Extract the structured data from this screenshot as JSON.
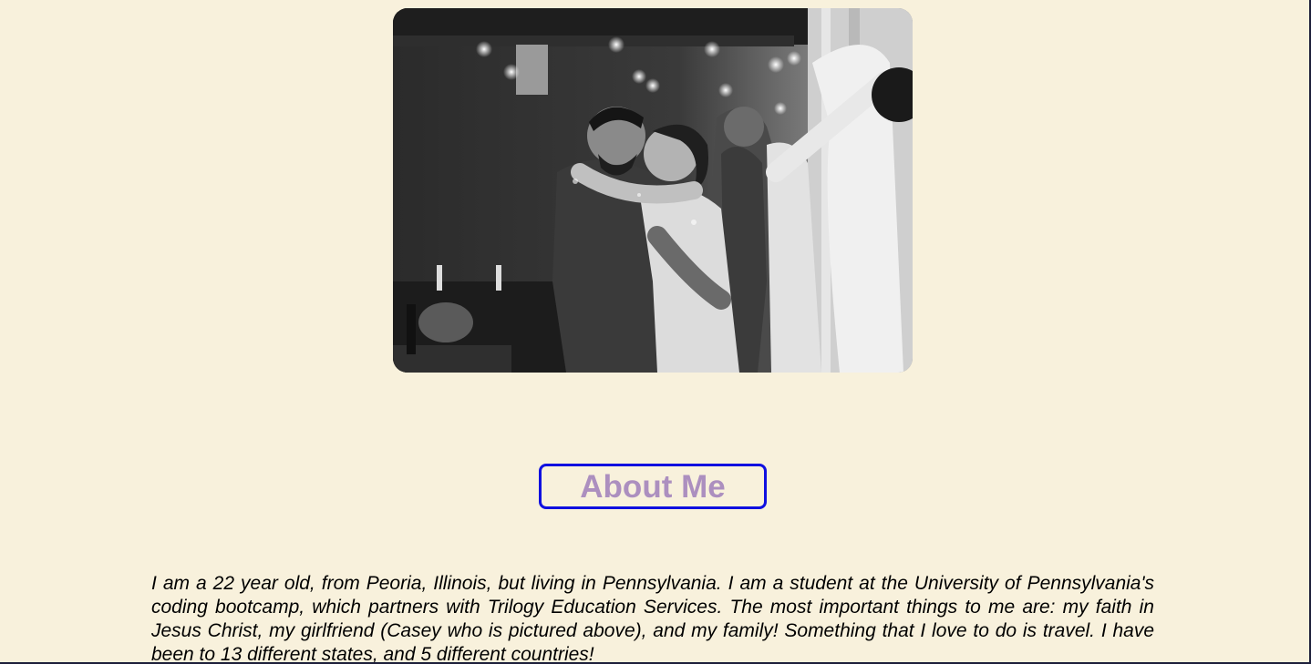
{
  "photo": {
    "alt": "Couple embracing and dancing at a celebration, black and white photo",
    "icon": "photo-image"
  },
  "about": {
    "heading": "About Me",
    "heading_color": "#ac8fbf",
    "border_color": "#1010e0",
    "bio": "I am a 22 year old, from Peoria, Illinois, but living in Pennsylvania. I am a student at the University of Pennsylvania's coding bootcamp, which partners with Trilogy Education Services. The most important things to me are: my faith in Jesus Christ, my girlfriend (Casey who is pictured above), and my family! Something that I love to do is travel. I have been to 13 different states, and 5 different countries!"
  },
  "theme": {
    "background": "#f8f1dc",
    "text": "#000000"
  }
}
